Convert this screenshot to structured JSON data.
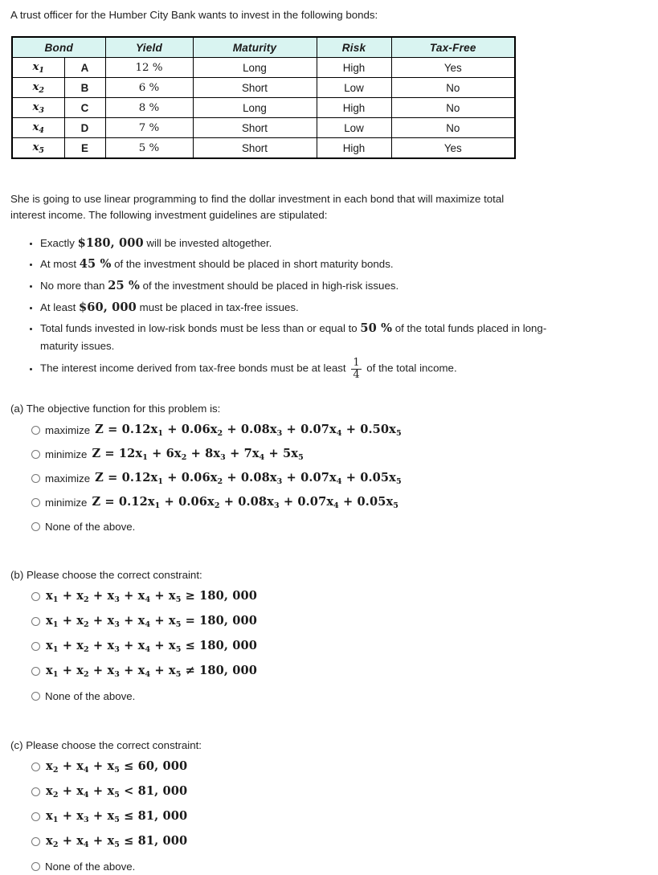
{
  "intro": "A trust officer for the Humber City Bank wants to invest in the following bonds:",
  "table": {
    "headers": [
      "Bond",
      "Yield",
      "Maturity",
      "Risk",
      "Tax-Free"
    ],
    "rows": [
      {
        "var": "x",
        "sub": "1",
        "letter": "A",
        "yield": "12 %",
        "maturity": "Long",
        "risk": "High",
        "taxfree": "Yes"
      },
      {
        "var": "x",
        "sub": "2",
        "letter": "B",
        "yield": "6 %",
        "maturity": "Short",
        "risk": "Low",
        "taxfree": "No"
      },
      {
        "var": "x",
        "sub": "3",
        "letter": "C",
        "yield": "8 %",
        "maturity": "Long",
        "risk": "High",
        "taxfree": "No"
      },
      {
        "var": "x",
        "sub": "4",
        "letter": "D",
        "yield": "7 %",
        "maturity": "Short",
        "risk": "Low",
        "taxfree": "No"
      },
      {
        "var": "x",
        "sub": "5",
        "letter": "E",
        "yield": "5 %",
        "maturity": "Short",
        "risk": "High",
        "taxfree": "Yes"
      }
    ]
  },
  "paragraph": "She is going to use linear programming to find the dollar investment in each bond that will maximize total interest income. The following investment guidelines are stipulated:",
  "guidelines": [
    {
      "pre": "Exactly ",
      "math": "$180, 000",
      "post": " will be invested altogether."
    },
    {
      "pre": "At most ",
      "math": "45 %",
      "post": "  of the investment should be placed in short maturity bonds."
    },
    {
      "pre": "No more than ",
      "math": "25 %",
      "post": "  of the investment should be placed in high-risk issues."
    },
    {
      "pre": "At least ",
      "math": "$60, 000",
      "post": " must be placed in tax-free issues."
    },
    {
      "pre": "Total funds invested in low-risk bonds must be less than or equal to ",
      "math": "50 %",
      "post": "  of the total funds placed in long-maturity issues."
    },
    {
      "pre": "The interest income derived from tax-free bonds must be at least ",
      "frac_num": "1",
      "frac_den": "4",
      "post": " of the total income."
    }
  ],
  "questions": [
    {
      "prompt": "(a) The objective function for this problem is:",
      "options": [
        {
          "lead": "maximize",
          "math": "Z = 0.12x₁ + 0.06x₂ + 0.08x₃ + 0.07x₄ + 0.50x₅"
        },
        {
          "lead": "minimize",
          "math": "Z = 12x₁ + 6x₂ + 8x₃ + 7x₄ + 5x₅"
        },
        {
          "lead": "maximize",
          "math": "Z = 0.12x₁ + 0.06x₂ + 0.08x₃ + 0.07x₄ + 0.05x₅"
        },
        {
          "lead": "minimize",
          "math": "Z = 0.12x₁ + 0.06x₂ + 0.08x₃ + 0.07x₄ + 0.05x₅"
        },
        {
          "lead": "",
          "text": "None of the above."
        }
      ]
    },
    {
      "prompt": "(b) Please choose the correct constraint:",
      "options": [
        {
          "lead": "",
          "math": "x₁ + x₂ + x₃ + x₄ + x₅ ≥ 180, 000"
        },
        {
          "lead": "",
          "math": "x₁ + x₂ + x₃ + x₄ + x₅ = 180, 000"
        },
        {
          "lead": "",
          "math": "x₁ + x₂ + x₃ + x₄ + x₅ ≤ 180, 000"
        },
        {
          "lead": "",
          "math": "x₁ + x₂ + x₃ + x₄ + x₅ ≠ 180, 000"
        },
        {
          "lead": "",
          "text": "None of the above."
        }
      ]
    },
    {
      "prompt": "(c) Please choose the correct constraint:",
      "options": [
        {
          "lead": "",
          "math": "x₂ + x₄ + x₅ ≤ 60, 000"
        },
        {
          "lead": "",
          "math": "x₂ + x₄ + x₅ < 81, 000"
        },
        {
          "lead": "",
          "math": "x₁ + x₃ + x₅ ≤ 81, 000"
        },
        {
          "lead": "",
          "math": "x₂ + x₄ + x₅ ≤ 81, 000"
        },
        {
          "lead": "",
          "text": "None of the above."
        }
      ]
    }
  ],
  "colors": {
    "header_fill": "#d9f4f1",
    "variable_fill": "#b0e8b0",
    "border": "#000000",
    "text": "#222222"
  }
}
